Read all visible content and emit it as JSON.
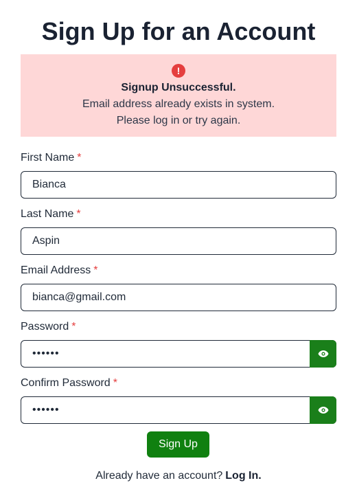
{
  "title": "Sign Up for an Account",
  "alert": {
    "icon": "exclamation-circle-icon",
    "icon_glyph": "!",
    "title": "Signup Unsuccessful.",
    "line1": "Email address already exists in system.",
    "line2": "Please log in or try again.",
    "background_color": "#fed7d7",
    "icon_color": "#e53e3e"
  },
  "form": {
    "required_marker": "*",
    "first_name": {
      "label": "First Name",
      "value": "Bianca"
    },
    "last_name": {
      "label": "Last Name",
      "value": "Aspin"
    },
    "email": {
      "label": "Email Address",
      "value": "bianca@gmail.com"
    },
    "password": {
      "label": "Password",
      "value": "••••••",
      "toggle_icon": "eye-icon"
    },
    "confirm_password": {
      "label": "Confirm Password",
      "value": "••••••",
      "toggle_icon": "eye-icon"
    },
    "submit_label": "Sign Up",
    "accent_color": "#108010"
  },
  "footer": {
    "prompt": "Already have an account?",
    "link_label": "Log In."
  }
}
